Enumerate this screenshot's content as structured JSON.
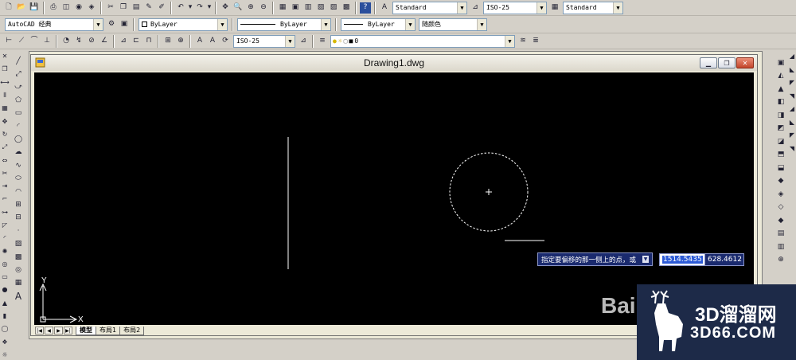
{
  "window": {
    "title": "Drawing1.dwg"
  },
  "toolbar1": {
    "text_style": "Standard",
    "dim_style": "ISO-25",
    "table_style": "Standard"
  },
  "toolbar2": {
    "workspace": "AutoCAD 经典",
    "color": "ByLayer",
    "linetype": "ByLayer",
    "lineweight": "ByLayer",
    "plot_style": "随颜色"
  },
  "toolbar3": {
    "dim_style": "ISO-25",
    "layer": "0"
  },
  "layout_tabs": [
    "模型",
    "布局1",
    "布局2"
  ],
  "active_tab": "模型",
  "command": {
    "prompt": "指定要偏移的那一侧上的点，或",
    "x_value": "1514.5435",
    "y_value": "628.4612"
  },
  "ucs": {
    "x_label": "X",
    "y_label": "Y"
  },
  "watermarks": {
    "baidu": "Bai",
    "brand_big": "3D溜溜网",
    "brand_small": "3D66.COM"
  },
  "icons": {
    "toolbar1": [
      "new-icon",
      "open-icon",
      "save-icon",
      "print-icon",
      "preview-icon",
      "publish-icon",
      "3d-print-icon",
      "cut-icon",
      "copy-icon",
      "paste-icon",
      "match-properties-icon",
      "block-editor-icon",
      "undo-icon",
      "redo-icon",
      "pan-icon",
      "zoom-realtime-icon",
      "zoom-window-icon",
      "zoom-previous-icon",
      "properties-icon",
      "design-center-icon",
      "tool-palettes-icon",
      "sheet-set-icon",
      "markup-icon",
      "calculator-icon",
      "help-icon"
    ],
    "left_draw": [
      "line-icon",
      "construction-line-icon",
      "polyline-icon",
      "polygon-icon",
      "rectangle-icon",
      "arc-icon",
      "circle-icon",
      "revision-cloud-icon",
      "spline-icon",
      "ellipse-icon",
      "ellipse-arc-icon",
      "insert-block-icon",
      "make-block-icon",
      "point-icon",
      "hatch-icon",
      "gradient-icon",
      "region-icon",
      "table-icon",
      "multiline-text-icon"
    ],
    "colors": {
      "canvas": "#000000",
      "drawing": "#ffffff",
      "tooltip": "#1a2a6e",
      "highlight": "#2c5ad6",
      "close": "#c2442a"
    }
  }
}
